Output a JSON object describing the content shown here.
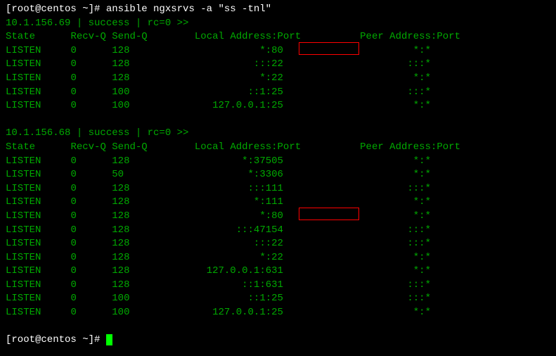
{
  "command_line1": "[root@centos ~]# ansible ngxsrvs -a \"ss -tnl\"",
  "host1": {
    "header": "10.1.156.69 | success | rc=0 >>",
    "colState": "State",
    "colRecvQ": "Recv-Q",
    "colSendQ": "Send-Q",
    "colLocal": "Local Address:Port",
    "colPeer": "Peer Address:Port",
    "rows": [
      {
        "state": "LISTEN",
        "recvq": "0",
        "sendq": "128",
        "local": "*:80",
        "peer": "*:*"
      },
      {
        "state": "LISTEN",
        "recvq": "0",
        "sendq": "128",
        "local": ":::22",
        "peer": ":::*"
      },
      {
        "state": "LISTEN",
        "recvq": "0",
        "sendq": "128",
        "local": "*:22",
        "peer": "*:*"
      },
      {
        "state": "LISTEN",
        "recvq": "0",
        "sendq": "100",
        "local": "::1:25",
        "peer": ":::*"
      },
      {
        "state": "LISTEN",
        "recvq": "0",
        "sendq": "100",
        "local": "127.0.0.1:25",
        "peer": "*:*"
      }
    ]
  },
  "host2": {
    "header": "10.1.156.68 | success | rc=0 >>",
    "colState": "State",
    "colRecvQ": "Recv-Q",
    "colSendQ": "Send-Q",
    "colLocal": "Local Address:Port",
    "colPeer": "Peer Address:Port",
    "rows": [
      {
        "state": "LISTEN",
        "recvq": "0",
        "sendq": "128",
        "local": "*:37505",
        "peer": "*:*"
      },
      {
        "state": "LISTEN",
        "recvq": "0",
        "sendq": "50",
        "local": "*:3306",
        "peer": "*:*"
      },
      {
        "state": "LISTEN",
        "recvq": "0",
        "sendq": "128",
        "local": ":::111",
        "peer": ":::*"
      },
      {
        "state": "LISTEN",
        "recvq": "0",
        "sendq": "128",
        "local": "*:111",
        "peer": "*:*"
      },
      {
        "state": "LISTEN",
        "recvq": "0",
        "sendq": "128",
        "local": "*:80",
        "peer": "*:*"
      },
      {
        "state": "LISTEN",
        "recvq": "0",
        "sendq": "128",
        "local": ":::47154",
        "peer": ":::*"
      },
      {
        "state": "LISTEN",
        "recvq": "0",
        "sendq": "128",
        "local": ":::22",
        "peer": ":::*"
      },
      {
        "state": "LISTEN",
        "recvq": "0",
        "sendq": "128",
        "local": "*:22",
        "peer": "*:*"
      },
      {
        "state": "LISTEN",
        "recvq": "0",
        "sendq": "128",
        "local": "127.0.0.1:631",
        "peer": "*:*"
      },
      {
        "state": "LISTEN",
        "recvq": "0",
        "sendq": "128",
        "local": "::1:631",
        "peer": ":::*"
      },
      {
        "state": "LISTEN",
        "recvq": "0",
        "sendq": "100",
        "local": "::1:25",
        "peer": ":::*"
      },
      {
        "state": "LISTEN",
        "recvq": "0",
        "sendq": "100",
        "local": "127.0.0.1:25",
        "peer": "*:*"
      }
    ]
  },
  "prompt2": "[root@centos ~]# ",
  "blank": " "
}
